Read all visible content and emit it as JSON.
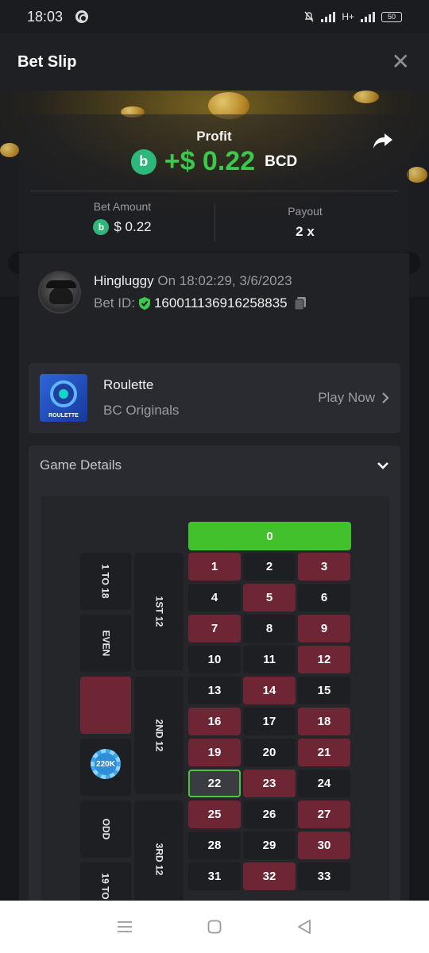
{
  "status_bar": {
    "time": "18:03",
    "network": "H+",
    "battery": "50"
  },
  "header": {
    "title": "Bet Slip",
    "close_label": "✕"
  },
  "profit": {
    "label": "Profit",
    "value": "+$ 0.22",
    "currency": "BCD",
    "coin_symbol": "b"
  },
  "bet_amount": {
    "label": "Bet Amount",
    "value": "$ 0.22"
  },
  "payout": {
    "label": "Payout",
    "value": "2 x"
  },
  "user": {
    "name": "Hingluggy",
    "on_text": "On 18:02:29, 3/6/2023",
    "bet_id_label": "Bet ID:",
    "bet_id": "160011136916258835"
  },
  "game": {
    "name": "Roulette",
    "provider": "BC Originals",
    "thumb_label": "ROULETTE",
    "play_label": "Play Now"
  },
  "details": {
    "title": "Game Details"
  },
  "board": {
    "zero": "0",
    "rows": [
      [
        "1",
        "2",
        "3"
      ],
      [
        "4",
        "5",
        "6"
      ],
      [
        "7",
        "8",
        "9"
      ],
      [
        "10",
        "11",
        "12"
      ],
      [
        "13",
        "14",
        "15"
      ],
      [
        "16",
        "17",
        "18"
      ],
      [
        "19",
        "20",
        "21"
      ],
      [
        "22",
        "23",
        "24"
      ],
      [
        "25",
        "26",
        "27"
      ],
      [
        "28",
        "29",
        "30"
      ],
      [
        "31",
        "32",
        "33"
      ]
    ],
    "red_numbers": [
      "1",
      "3",
      "5",
      "7",
      "9",
      "12",
      "14",
      "16",
      "18",
      "19",
      "21",
      "23",
      "25",
      "27",
      "30",
      "32"
    ],
    "selected": "22",
    "dozens": [
      "1ST 12",
      "2ND 12",
      "3RD 12"
    ],
    "outside": [
      "1 TO 18",
      "EVEN",
      "ODD",
      "19 TO"
    ],
    "chip_label": "220K"
  },
  "colors": {
    "red": "#6e2534",
    "black": "#1e1f22",
    "green": "#43c12d",
    "profit": "#3bc84d"
  }
}
